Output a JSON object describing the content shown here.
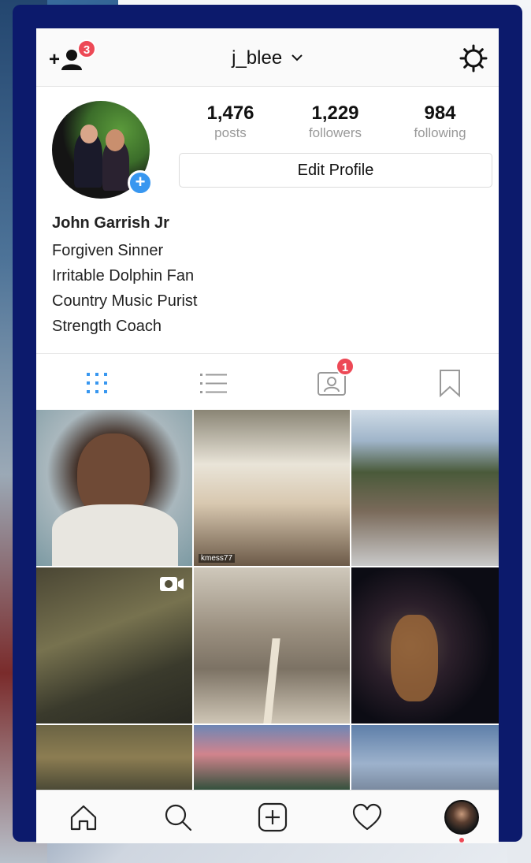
{
  "header": {
    "username": "j_blee",
    "discover_badge": "3"
  },
  "profile": {
    "stats": [
      {
        "value": "1,476",
        "label": "posts"
      },
      {
        "value": "1,229",
        "label": "followers"
      },
      {
        "value": "984",
        "label": "following"
      }
    ],
    "edit_label": "Edit Profile",
    "full_name": "John Garrish Jr",
    "bio": [
      "Forgiven Sinner",
      "Irritable Dolphin Fan",
      "Country Music Purist",
      "Strength Coach"
    ]
  },
  "tabs": {
    "tagged_badge": "1",
    "active": "grid"
  },
  "grid": {
    "photo2_credit": "kmess77"
  },
  "colors": {
    "accent": "#3897f0",
    "badge": "#ed4956",
    "frame": "#0c1a6c"
  },
  "icons": [
    "add-user-icon",
    "chevron-down-icon",
    "gear-icon",
    "grid-icon",
    "list-icon",
    "tagged-icon",
    "bookmark-icon",
    "video-icon",
    "home-icon",
    "search-icon",
    "add-post-icon",
    "heart-icon"
  ]
}
